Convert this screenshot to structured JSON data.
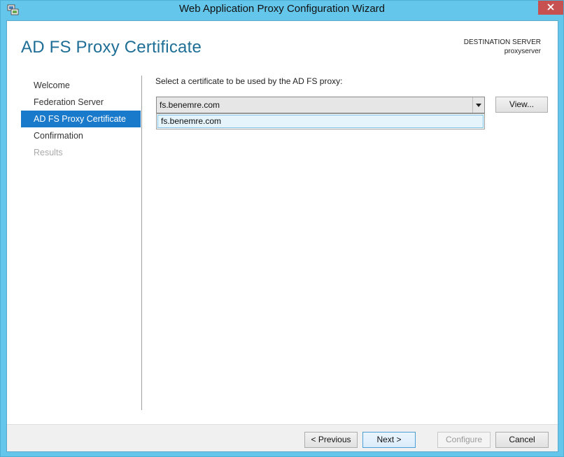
{
  "window": {
    "title": "Web Application Proxy Configuration Wizard",
    "accent_color": "#64c6ea",
    "close_color": "#c75050"
  },
  "header": {
    "page_title": "AD FS Proxy Certificate",
    "destination_label": "DESTINATION SERVER",
    "destination_server": "proxyserver"
  },
  "nav": {
    "items": [
      {
        "label": "Welcome",
        "state": "normal"
      },
      {
        "label": "Federation Server",
        "state": "normal"
      },
      {
        "label": "AD FS Proxy Certificate",
        "state": "active"
      },
      {
        "label": "Confirmation",
        "state": "normal"
      },
      {
        "label": "Results",
        "state": "disabled"
      }
    ],
    "active_color": "#1979ca"
  },
  "main": {
    "prompt": "Select a certificate to be used by the AD FS proxy:",
    "certificate_select": {
      "selected": "fs.benemre.com",
      "options": [
        "fs.benemre.com"
      ]
    },
    "view_button": "View..."
  },
  "footer": {
    "previous_button": "< Previous",
    "next_button": "Next >",
    "configure_button": "Configure",
    "cancel_button": "Cancel"
  }
}
